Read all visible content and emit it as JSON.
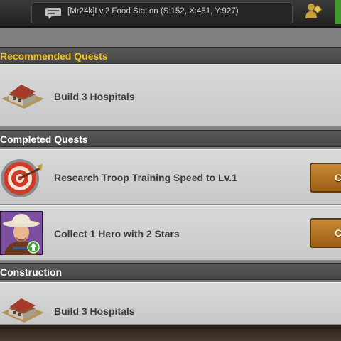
{
  "topbar": {
    "chat_text": "[Mr24k]Lv.2 Food Station (S:152, X:451, Y:927)"
  },
  "sections": {
    "recommended": "Recommended Quests",
    "completed": "Completed Quests",
    "construction": "Construction"
  },
  "quests": {
    "recommended_1": "Build 3 Hospitals",
    "completed_1": "Research Troop Training Speed  to Lv.1",
    "completed_2": "Collect 1 Hero with 2 Stars",
    "construction_1": "Build 3 Hospitals"
  },
  "buttons": {
    "claim_1": "C",
    "claim_2": "C"
  },
  "colors": {
    "recommended_header_text": "#f2c41c",
    "section_header_text": "#ffffff",
    "button": "#b8782a"
  },
  "icons": {
    "chat": "chat-icon",
    "alliance": "alliance-icon",
    "hospital": "hospital-icon",
    "target": "target-icon",
    "hero": "hero-portrait-icon",
    "upgrade": "upgrade-arrow-icon"
  }
}
